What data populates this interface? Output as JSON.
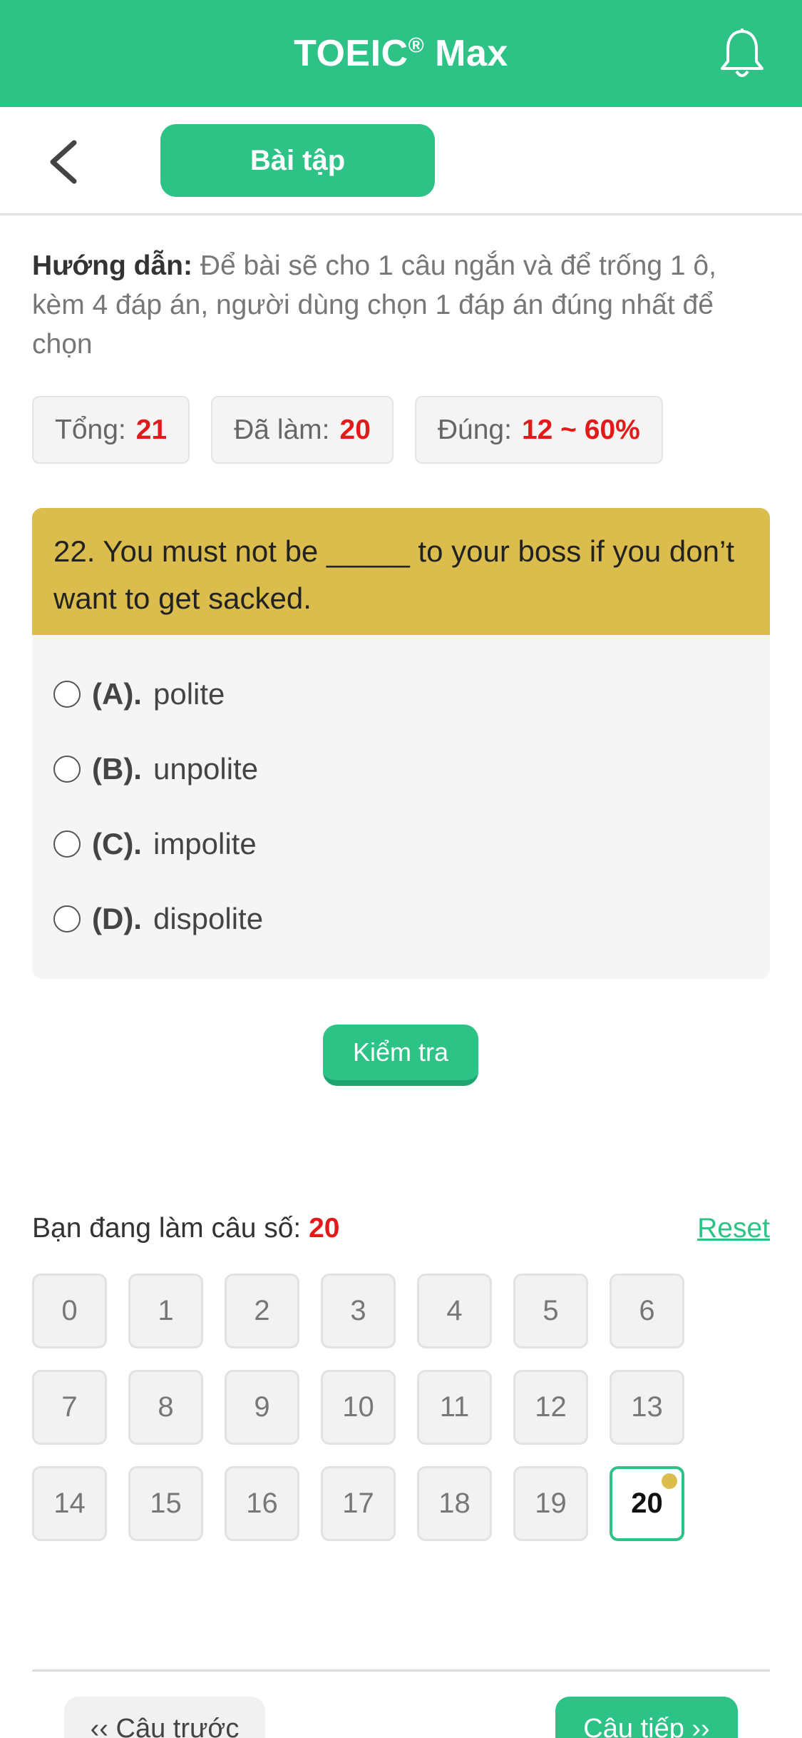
{
  "header": {
    "title": "TOEIC",
    "title_mark": "®",
    "title_suffix": " Max",
    "bell_icon": "bell-icon"
  },
  "subnav": {
    "back_icon": "chevron-left-icon",
    "tab_label": "Bài tập"
  },
  "instructions": {
    "label": "Hướng dẫn:",
    "text": " Để bài sẽ cho 1 câu ngắn và để trống 1 ô, kèm 4 đáp án, người dùng chọn 1 đáp án đúng nhất để chọn"
  },
  "stats": [
    {
      "label": "Tổng:",
      "value": "21"
    },
    {
      "label": "Đã làm:",
      "value": "20"
    },
    {
      "label": "Đúng:",
      "value": "12 ~ 60%"
    }
  ],
  "question": {
    "text": "22. You must not be _____ to your boss if you don’t want to get sacked.",
    "options": [
      {
        "key": "(A).",
        "text": "polite"
      },
      {
        "key": "(B).",
        "text": "unpolite"
      },
      {
        "key": "(C).",
        "text": "impolite"
      },
      {
        "key": "(D).",
        "text": "dispolite"
      }
    ]
  },
  "check_button": "Kiểm tra",
  "progress": {
    "label": "Bạn đang làm câu số:",
    "current": "20",
    "reset": "Reset"
  },
  "question_numbers": [
    "0",
    "1",
    "2",
    "3",
    "4",
    "5",
    "6",
    "7",
    "8",
    "9",
    "10",
    "11",
    "12",
    "13",
    "14",
    "15",
    "16",
    "17",
    "18",
    "19",
    "20"
  ],
  "active_number": "20",
  "nav": {
    "prev": "‹‹ Câu trước",
    "next": "Câu tiếp ››"
  },
  "colors": {
    "primary": "#2dc386",
    "question_bg": "#dbbd4e",
    "highlight": "#e21a1a"
  }
}
